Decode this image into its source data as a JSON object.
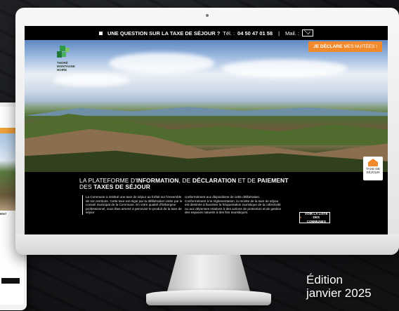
{
  "topbar": {
    "question": "UNE QUESTION SUR LA TAXE DE SÉJOUR ?",
    "tel_label": "Tél. :",
    "tel_number": "04 50 47 01 58",
    "separator": "|",
    "mail_label": "Mail. :"
  },
  "logo": {
    "line1": "THORÉ",
    "line2": "MONTAGNE",
    "line3": "NOIRE"
  },
  "declare_button": {
    "bold": "JE DÉCLARE",
    "rest": "MES NUITÉES !"
  },
  "headline": {
    "p1": "LA PLATEFORME D'",
    "b1": "INFORMATION",
    "p2": ", DE ",
    "b2": "DÉCLARATION",
    "p3": " ET DE ",
    "b3": "PAIEMENT",
    "p4": "DES ",
    "b4": "TAXES DE SÉJOUR"
  },
  "column1": "La Commune  a institué une taxe de séjour au forfait sur l'ensemble de son territoire. Cette taxe est régie par la délibération votée par le conseil municipal de la Commune. En votre qualité d'hébergeur professionnel, vous êtes amené à percevoir le produit de la taxe de séjour",
  "column2": "conformément aux dispositions de cette délibération. Conformément à la réglementation, la recette de la taxe de séjour est destinée à favoriser la fréquentation touristique de la collectivité ou aux dépenses relatives à des actions de protection et de gestion des espaces naturels à des fins touristiques.",
  "list_button": {
    "arrow": "»",
    "line1": "VOIR LA LISTE",
    "line2": "DES COMMUNES"
  },
  "tax_badge": {
    "line1": "TAXE DE",
    "line2": "SÉJOUR"
  },
  "phone": {
    "label": "MENT",
    "btn": "VOIR LA LISTE DES COMMUNES"
  },
  "edition": {
    "line1": "Édition",
    "line2": "janvier 2025"
  }
}
